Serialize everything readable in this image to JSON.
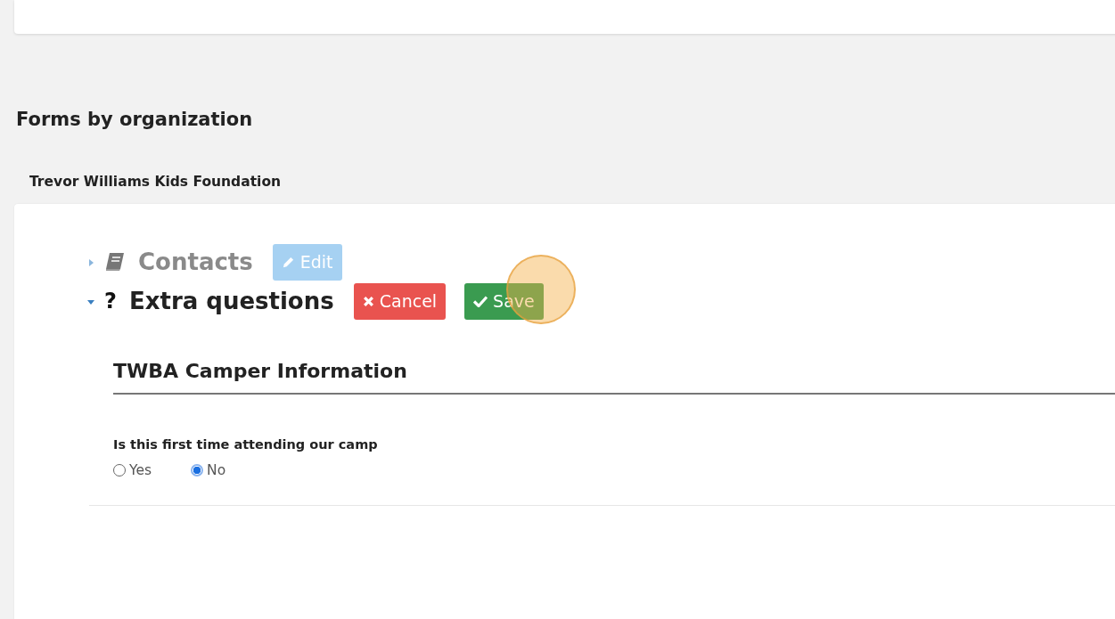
{
  "heading": "Forms by organization",
  "organization": "Trevor Williams Kids Foundation",
  "sections": [
    {
      "kind": "contacts",
      "title": "Contacts",
      "expanded": false,
      "disabled": true,
      "buttons": [
        {
          "kind": "edit",
          "label": "Edit",
          "disabled": true,
          "highlighted": false
        }
      ]
    },
    {
      "kind": "questions",
      "title": "Extra questions",
      "icon_text": "?",
      "expanded": true,
      "disabled": false,
      "buttons": [
        {
          "kind": "cancel",
          "label": "Cancel",
          "disabled": false,
          "highlighted": false
        },
        {
          "kind": "save",
          "label": "Save",
          "disabled": false,
          "highlighted": true
        }
      ],
      "form": {
        "title": "TWBA Camper Information",
        "questions": [
          {
            "label": "Is this first time attending our camp",
            "options": [
              {
                "label": "Yes",
                "selected": false
              },
              {
                "label": "No",
                "selected": true
              }
            ]
          }
        ]
      }
    }
  ]
}
